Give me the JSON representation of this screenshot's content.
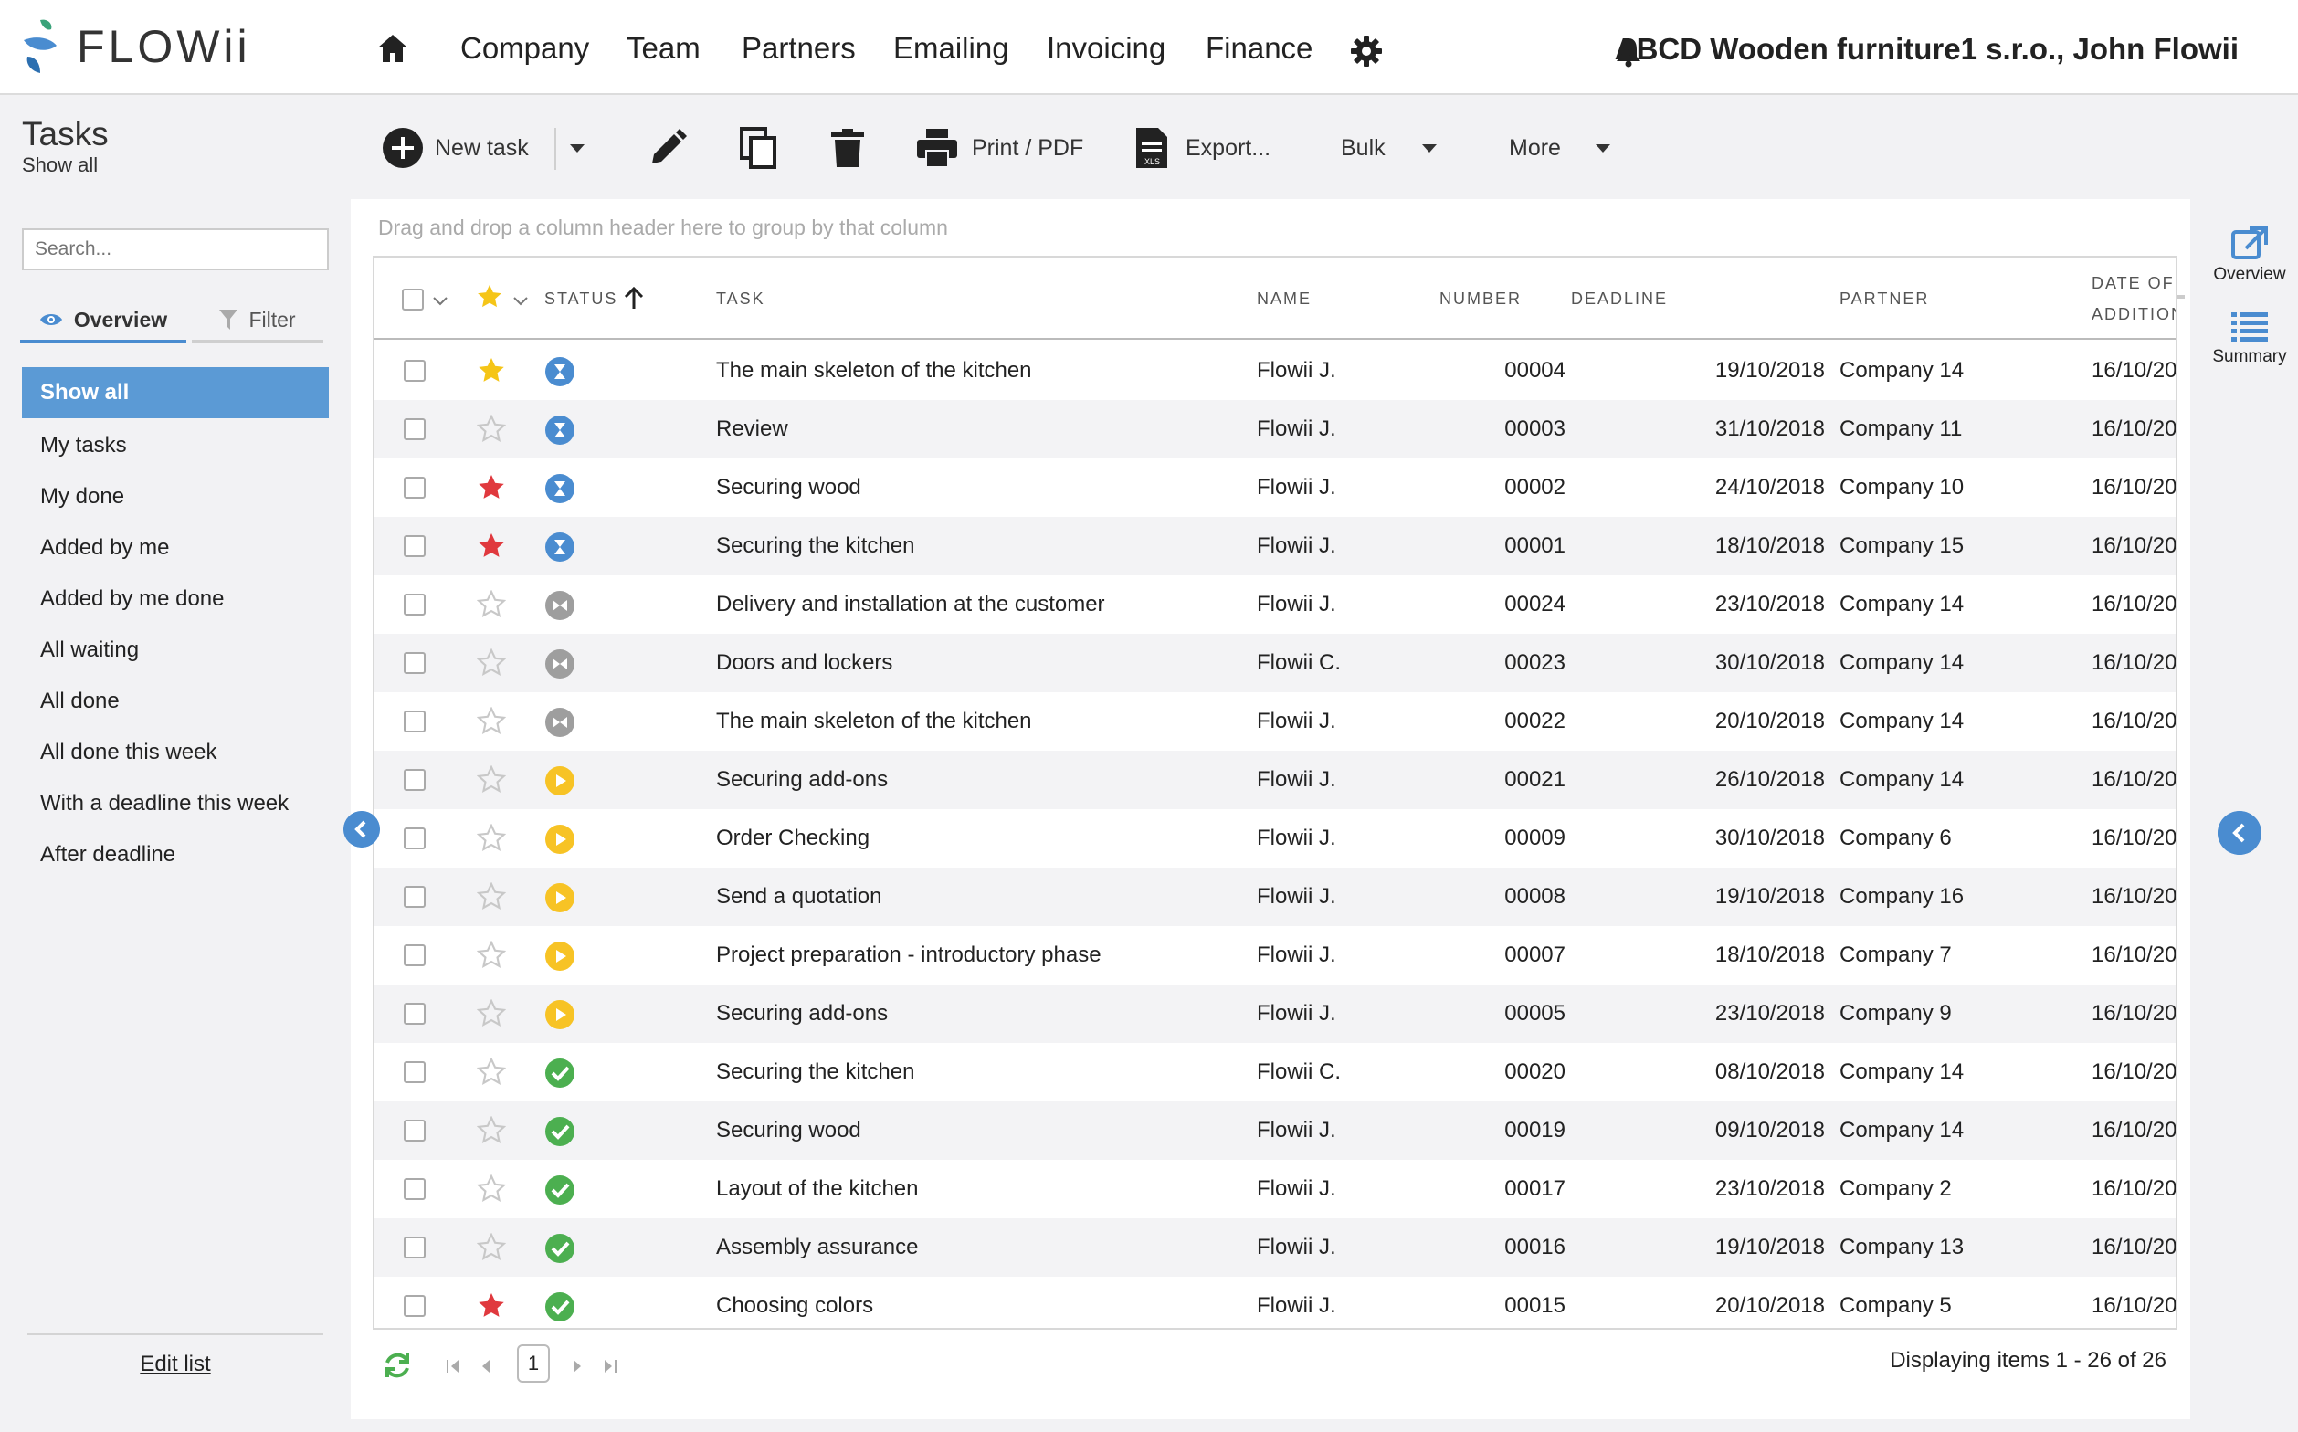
{
  "app": {
    "logo_text": "FLOWii"
  },
  "nav": {
    "items": [
      {
        "label": "Company"
      },
      {
        "label": "Team"
      },
      {
        "label": "Partners"
      },
      {
        "label": "Emailing"
      },
      {
        "label": "Invoicing"
      },
      {
        "label": "Finance"
      }
    ],
    "account": "ABCD Wooden furniture1 s.r.o., John Flowii"
  },
  "page": {
    "title": "Tasks",
    "subtitle": "Show all"
  },
  "toolbar": {
    "new_task": "New task",
    "print": "Print / PDF",
    "export": "Export...",
    "bulk": "Bulk",
    "more": "More",
    "xls_badge": "XLS"
  },
  "sidebar": {
    "search_placeholder": "Search...",
    "tab_overview": "Overview",
    "tab_filter": "Filter",
    "items": [
      {
        "label": "Show all",
        "active": true
      },
      {
        "label": "My tasks"
      },
      {
        "label": "My done"
      },
      {
        "label": "Added by me"
      },
      {
        "label": "Added by me done"
      },
      {
        "label": "All waiting"
      },
      {
        "label": "All done"
      },
      {
        "label": "All done this week"
      },
      {
        "label": "With a deadline this week"
      },
      {
        "label": "After deadline"
      }
    ],
    "edit_list": "Edit list"
  },
  "grid": {
    "group_hint": "Drag and drop a column header here to group by that column",
    "columns": {
      "status": "STATUS",
      "task": "TASK",
      "name": "NAME",
      "number": "NUMBER",
      "deadline": "DEADLINE",
      "partner": "PARTNER",
      "date_added_1": "DATE OF",
      "date_added_2": "ADDITION"
    },
    "rows": [
      {
        "star": "gold",
        "status": "waiting",
        "task": "The main skeleton of the kitchen",
        "name": "Flowii J.",
        "number": "00004",
        "deadline": "19/10/2018",
        "partner": "Company 14",
        "added": "16/10/20"
      },
      {
        "star": "none",
        "status": "waiting",
        "task": "Review",
        "name": "Flowii J.",
        "number": "00003",
        "deadline": "31/10/2018",
        "partner": "Company 11",
        "added": "16/10/20"
      },
      {
        "star": "red",
        "status": "waiting",
        "task": "Securing wood",
        "name": "Flowii J.",
        "number": "00002",
        "deadline": "24/10/2018",
        "partner": "Company 10",
        "added": "16/10/20"
      },
      {
        "star": "red",
        "status": "waiting",
        "task": "Securing the kitchen",
        "name": "Flowii J.",
        "number": "00001",
        "deadline": "18/10/2018",
        "partner": "Company 15",
        "added": "16/10/20"
      },
      {
        "star": "none",
        "status": "paused",
        "task": "Delivery and installation at the customer",
        "name": "Flowii J.",
        "number": "00024",
        "deadline": "23/10/2018",
        "partner": "Company 14",
        "added": "16/10/20"
      },
      {
        "star": "none",
        "status": "paused",
        "task": "Doors and lockers",
        "name": "Flowii C.",
        "number": "00023",
        "deadline": "30/10/2018",
        "partner": "Company 14",
        "added": "16/10/20"
      },
      {
        "star": "none",
        "status": "paused",
        "task": "The main skeleton of the kitchen",
        "name": "Flowii J.",
        "number": "00022",
        "deadline": "20/10/2018",
        "partner": "Company 14",
        "added": "16/10/20"
      },
      {
        "star": "none",
        "status": "in-progress",
        "task": "Securing add-ons",
        "name": "Flowii J.",
        "number": "00021",
        "deadline": "26/10/2018",
        "partner": "Company 14",
        "added": "16/10/20"
      },
      {
        "star": "none",
        "status": "in-progress",
        "task": "Order Checking",
        "name": "Flowii J.",
        "number": "00009",
        "deadline": "30/10/2018",
        "partner": "Company 6",
        "added": "16/10/20"
      },
      {
        "star": "none",
        "status": "in-progress",
        "task": "Send a quotation",
        "name": "Flowii J.",
        "number": "00008",
        "deadline": "19/10/2018",
        "partner": "Company 16",
        "added": "16/10/20"
      },
      {
        "star": "none",
        "status": "in-progress",
        "task": "Project preparation - introductory phase",
        "name": "Flowii J.",
        "number": "00007",
        "deadline": "18/10/2018",
        "partner": "Company 7",
        "added": "16/10/20"
      },
      {
        "star": "none",
        "status": "in-progress",
        "task": "Securing add-ons",
        "name": "Flowii J.",
        "number": "00005",
        "deadline": "23/10/2018",
        "partner": "Company 9",
        "added": "16/10/20"
      },
      {
        "star": "none",
        "status": "done",
        "task": "Securing the kitchen",
        "name": "Flowii C.",
        "number": "00020",
        "deadline": "08/10/2018",
        "partner": "Company 14",
        "added": "16/10/20"
      },
      {
        "star": "none",
        "status": "done",
        "task": "Securing wood",
        "name": "Flowii J.",
        "number": "00019",
        "deadline": "09/10/2018",
        "partner": "Company 14",
        "added": "16/10/20"
      },
      {
        "star": "none",
        "status": "done",
        "task": "Layout of the kitchen",
        "name": "Flowii J.",
        "number": "00017",
        "deadline": "23/10/2018",
        "partner": "Company 2",
        "added": "16/10/20"
      },
      {
        "star": "none",
        "status": "done",
        "task": "Assembly assurance",
        "name": "Flowii J.",
        "number": "00016",
        "deadline": "19/10/2018",
        "partner": "Company 13",
        "added": "16/10/20"
      },
      {
        "star": "red",
        "status": "done",
        "task": "Choosing colors",
        "name": "Flowii J.",
        "number": "00015",
        "deadline": "20/10/2018",
        "partner": "Company 5",
        "added": "16/10/20"
      }
    ]
  },
  "rail": {
    "overview": "Overview",
    "summary": "Summary"
  },
  "pager": {
    "page": "1",
    "items_text": "Displaying items 1 - 26 of 26"
  },
  "colors": {
    "accent": "#4a8cd0",
    "active_item": "#5b9ad5",
    "star_gold": "#f5c518",
    "star_red": "#e0393e",
    "status_waiting": "#4a8cd0",
    "status_paused": "#9e9e9e",
    "status_in_progress": "#f7c325",
    "status_done": "#4caf50"
  },
  "icons": {
    "home": "home-icon",
    "settings": "gear-icon",
    "notifications": "bell-icon",
    "new_task": "plus-circle-icon",
    "edit": "pencil-icon",
    "copy": "copy-icon",
    "delete": "trash-icon",
    "print": "printer-icon",
    "export": "xls-file-icon",
    "overview_tab": "eye-icon",
    "filter_tab": "funnel-icon",
    "rail_overview": "external-link-icon",
    "rail_summary": "list-icon",
    "refresh": "refresh-icon"
  }
}
